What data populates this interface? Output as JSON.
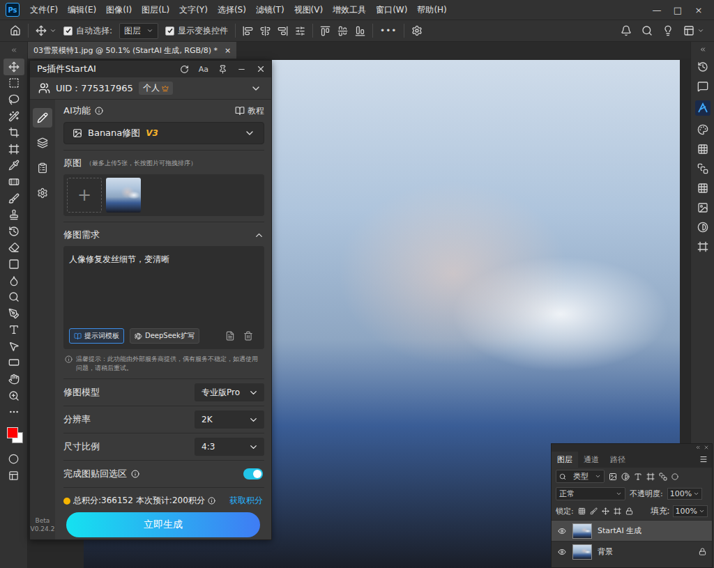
{
  "app": {
    "logo": "Ps"
  },
  "menu": [
    "文件(F)",
    "编辑(E)",
    "图像(I)",
    "图层(L)",
    "文字(Y)",
    "选择(S)",
    "滤镜(T)",
    "视图(V)",
    "增效工具",
    "窗口(W)",
    "帮助(H)"
  ],
  "window_controls": [
    "—",
    "□",
    "×"
  ],
  "options_bar": {
    "auto_select": {
      "label": "自动选择:",
      "checked": true
    },
    "target": "图层",
    "show_transform": {
      "label": "显示变换控件",
      "checked": true
    },
    "more": "•••"
  },
  "document_tab": {
    "title": "03雪景模特1.jpg @ 50.1% (StartAI 生成, RGB/8) *",
    "close": "×",
    "selected": true
  },
  "tools": [
    {
      "selected": true
    },
    {
      "selected": false
    },
    {
      "selected": false
    },
    {
      "selected": false
    },
    {
      "selected": false
    },
    {
      "selected": false
    },
    {
      "selected": false
    },
    {
      "selected": false
    },
    {
      "selected": false
    },
    {
      "selected": false
    },
    {
      "selected": false
    },
    {
      "selected": false
    },
    {
      "selected": false
    },
    {
      "selected": false
    },
    {
      "selected": false
    },
    {
      "selected": false
    },
    {
      "selected": false
    },
    {
      "selected": false
    },
    {
      "selected": false
    },
    {
      "selected": false
    },
    {
      "selected": false
    },
    {
      "selected": false
    }
  ],
  "swatches": {
    "foreground": "#ff0000",
    "background": "#ffffff"
  },
  "plugin": {
    "title": "Ps插件StartAI",
    "font_button": "Aa",
    "uid": "UID：775317965",
    "account": "个人",
    "sidebar": [
      {
        "selected": true
      },
      {
        "selected": false
      },
      {
        "selected": false
      },
      {
        "selected": false
      }
    ],
    "version": {
      "label": "Beta",
      "number": "V0.24.2"
    },
    "ai_function": {
      "label": "AI功能",
      "tutorial": "教程"
    },
    "function_select": {
      "value": "Banana修图",
      "badge": "V3"
    },
    "source": {
      "label": "原图",
      "hint": "（最多上传5张，长按图片可拖拽排序）",
      "add": "+",
      "images": [
        {
          "kind": "photo"
        }
      ]
    },
    "prompt": {
      "label": "修图需求",
      "expanded": true,
      "text": "人像修复发丝细节，变清晰",
      "template": "提示词模板",
      "expand": "DeepSeek扩写"
    },
    "notice": "温馨提示：此功能由外部服务商提供，偶有服务不稳定，如遇使用问题，请稍后重试。",
    "settings": [
      {
        "label": "修图模型",
        "kind": "select",
        "value": "专业版Pro"
      },
      {
        "label": "分辨率",
        "kind": "select",
        "value": "2K"
      },
      {
        "label": "尺寸比例",
        "kind": "select",
        "value": "4:3"
      },
      {
        "label": "完成图贴回选区",
        "kind": "toggle",
        "on": true
      }
    ],
    "credits": {
      "total": "总积分:366152",
      "estimate": "本次预计:200积分",
      "get": "获取积分"
    },
    "generate": "立即生成"
  },
  "layers_panel": {
    "tabs": [
      {
        "label": "图层",
        "selected": true
      },
      {
        "label": "通道",
        "selected": false
      },
      {
        "label": "路径",
        "selected": false
      }
    ],
    "filter": "类型",
    "blend": "正常",
    "opacity": {
      "label": "不透明度:",
      "value": "100%"
    },
    "lock_label": "锁定:",
    "fill": {
      "label": "填充:",
      "value": "100%"
    },
    "layers": [
      {
        "name": "StartAI 生成",
        "selected": true,
        "visible": true,
        "locked": false
      },
      {
        "name": "背景",
        "selected": false,
        "visible": true,
        "locked": true
      }
    ]
  }
}
